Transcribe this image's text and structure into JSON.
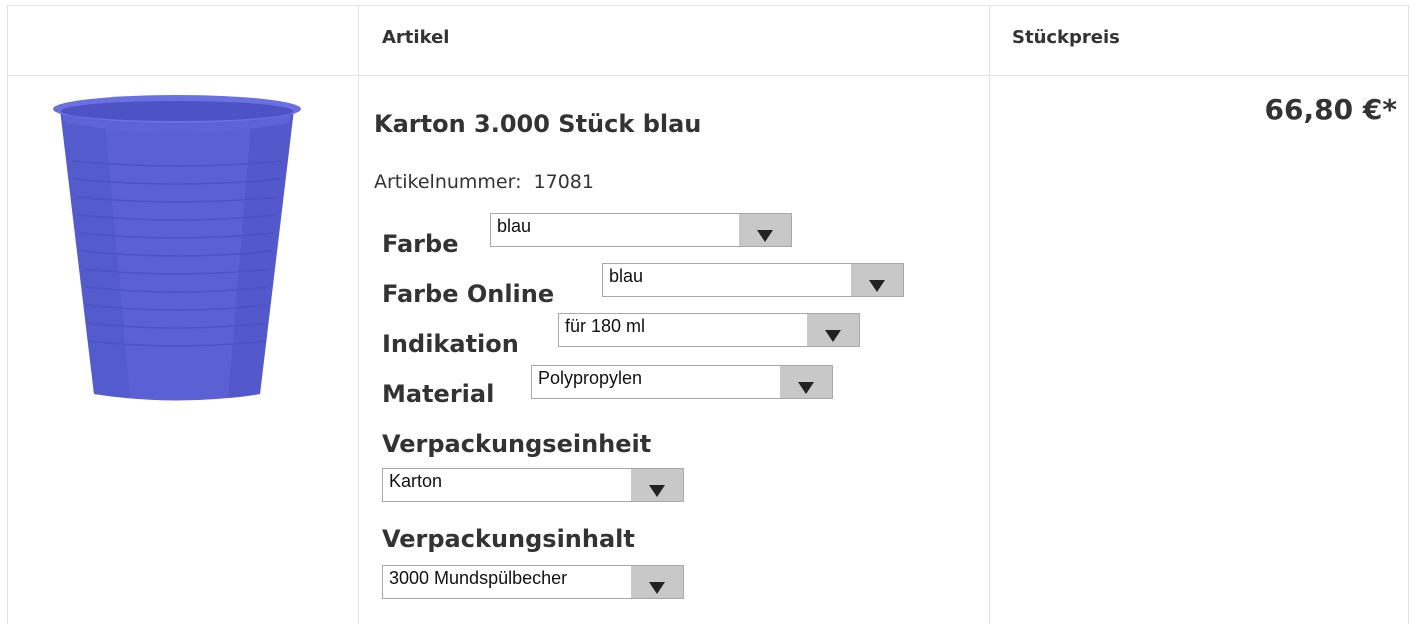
{
  "header": {
    "col_article": "Artikel",
    "col_unit_price": "Stückpreis"
  },
  "product": {
    "title": "Karton 3.000 Stück blau",
    "article_number_label": "Artikelnummer:",
    "article_number": "17081",
    "price": "66,80 €*",
    "image_icon": "blue-plastic-cup",
    "image_color": "#5a60d4",
    "options": {
      "farbe": {
        "label": "Farbe",
        "value": "blau"
      },
      "farbe_online": {
        "label": "Farbe Online",
        "value": "blau"
      },
      "indikation": {
        "label": "Indikation",
        "value": "für 180 ml"
      },
      "material": {
        "label": "Material",
        "value": "Polypropylen"
      },
      "verpackungseinheit": {
        "label": "Verpackungseinheit",
        "value": "Karton"
      },
      "verpackungsinhalt": {
        "label": "Verpackungsinhalt",
        "value": "3000 Mundspülbecher"
      }
    }
  }
}
